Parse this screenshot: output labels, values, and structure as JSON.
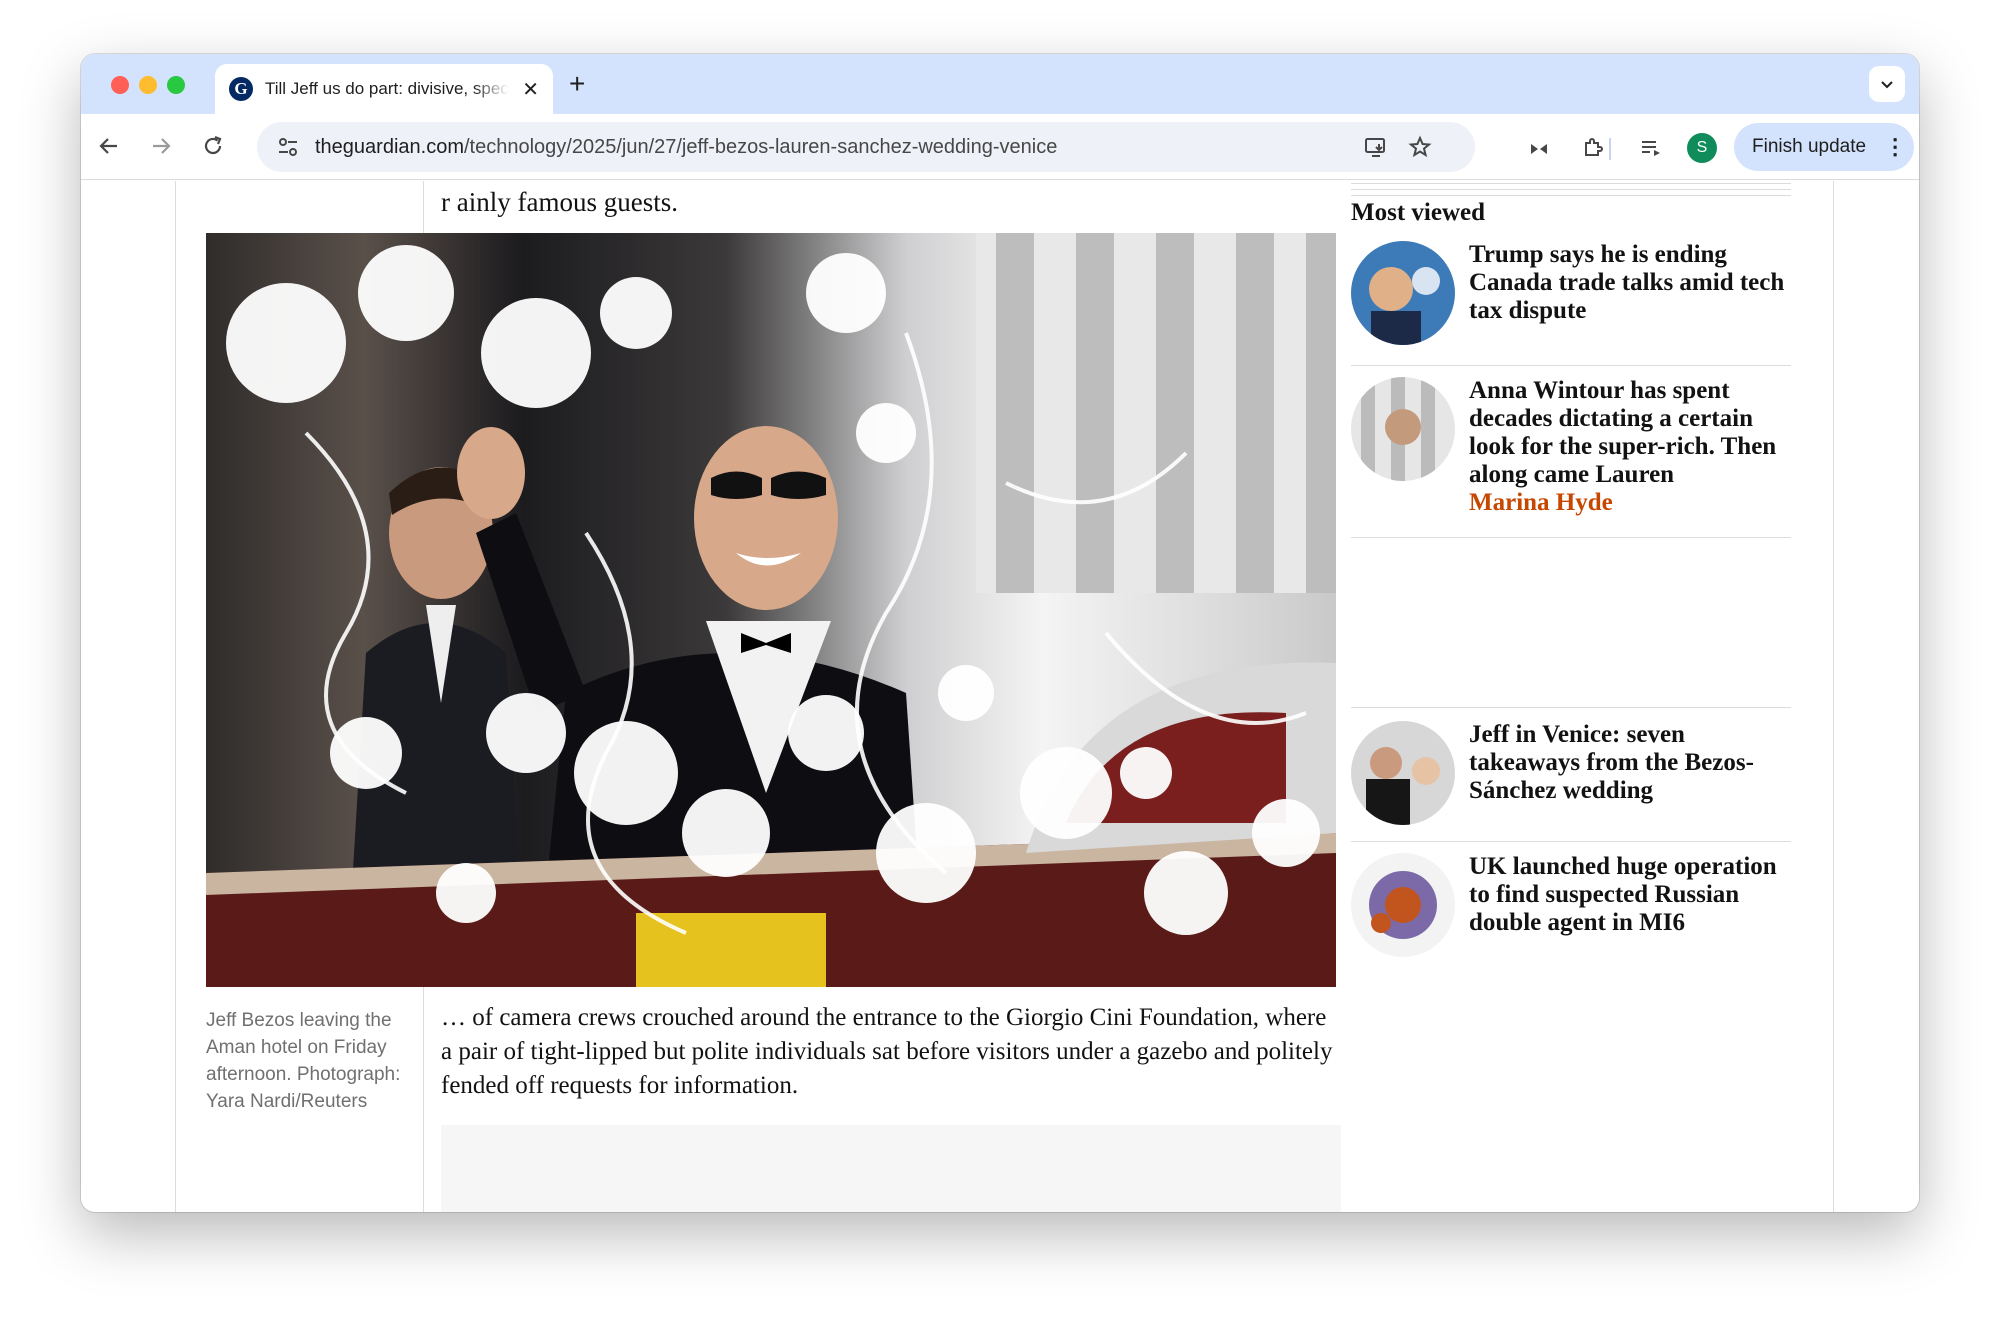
{
  "tab": {
    "title": "Till Jeff us do part: divisive, spectacular and bonkers",
    "favicon_letter": "G",
    "new_tab_label": "+"
  },
  "toolbar": {
    "url_domain": "theguardian.com",
    "url_path": "/technology/2025/jun/27/jeff-bezos-lauren-sanchez-wedding-venice",
    "profile_initial": "S",
    "finish_update_label": "Finish update"
  },
  "article": {
    "top_line_fragment": "r ainly famous guests.",
    "photo_description_alt": "Jeff Bezos waving from a boat",
    "caption": "Jeff Bezos leaving the Aman hotel on Friday afternoon. Photograph: Yara Nardi/Reuters",
    "body_paragraph": "… of camera crews crouched around the entrance to the Giorgio Cini Foundation, where a pair of tight-lipped but polite individuals sat before visitors under a gazebo and politely fended off requests for information."
  },
  "sidebar": {
    "most_viewed_title": "Most viewed",
    "items": [
      {
        "headline": "Trump says he is ending Canada trade talks amid tech tax dispute",
        "kicker": ""
      },
      {
        "headline": "Anna Wintour has spent decades dictating a certain look for the super-rich. Then along came Lauren",
        "kicker": "Marina Hyde"
      },
      {
        "headline": "",
        "kicker": ""
      },
      {
        "headline": "Jeff in Venice: seven takeaways from the Bezos-Sánchez wedding",
        "kicker": ""
      },
      {
        "headline": "UK launched huge operation to find suspected Russian double agent in MI6",
        "kicker": ""
      }
    ]
  },
  "colors": {
    "tabstrip": "#d3e3fd",
    "kicker": "#c74600",
    "guardian_blue": "#052962"
  }
}
